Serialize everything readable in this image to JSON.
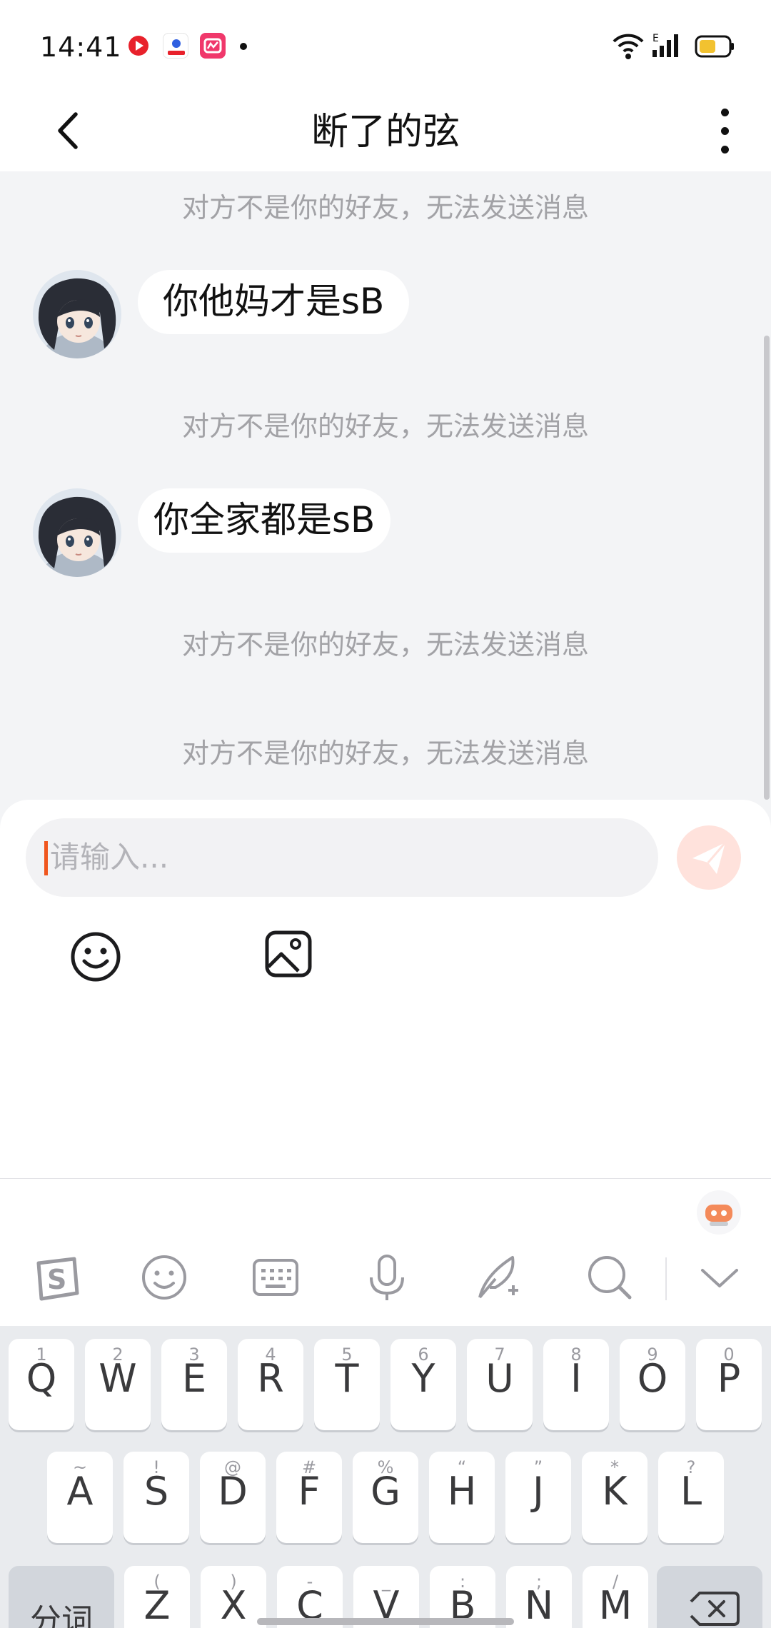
{
  "status_bar": {
    "time": "14:41",
    "app_icons": [
      "video-app-icon",
      "baidu-icon",
      "beauty-camera-icon"
    ],
    "battery_color": "#f2c230"
  },
  "header": {
    "title": "断了的弦",
    "back_icon": "chevron-left-icon",
    "more_icon": "more-vertical-icon"
  },
  "chat": {
    "system_notice": "对方不是你的好友，无法发送消息",
    "messages": [
      {
        "type": "system",
        "text": "对方不是你的好友，无法发送消息"
      },
      {
        "type": "received",
        "text": "你他妈才是sB"
      },
      {
        "type": "system",
        "text": "对方不是你的好友，无法发送消息"
      },
      {
        "type": "received",
        "text": "你全家都是sB"
      },
      {
        "type": "system",
        "text": "对方不是你的好友，无法发送消息"
      },
      {
        "type": "system",
        "text": "对方不是你的好友，无法发送消息"
      }
    ]
  },
  "composer": {
    "placeholder": "请输入...",
    "value": "",
    "send_icon": "paper-plane-icon",
    "accent": "#ff6b4d",
    "tools": [
      "emoji-icon",
      "image-icon"
    ]
  },
  "keyboard": {
    "toolbar_icons": [
      "sogou-logo-icon",
      "emoji-icon",
      "keyboard-icon",
      "microphone-icon",
      "quill-icon",
      "search-icon",
      "chevron-down-icon"
    ],
    "row1": [
      {
        "hint": "1",
        "key": "Q"
      },
      {
        "hint": "2",
        "key": "W"
      },
      {
        "hint": "3",
        "key": "E"
      },
      {
        "hint": "4",
        "key": "R"
      },
      {
        "hint": "5",
        "key": "T"
      },
      {
        "hint": "6",
        "key": "Y"
      },
      {
        "hint": "7",
        "key": "U"
      },
      {
        "hint": "8",
        "key": "I"
      },
      {
        "hint": "9",
        "key": "O"
      },
      {
        "hint": "0",
        "key": "P"
      }
    ],
    "row2": [
      {
        "hint": "~",
        "key": "A"
      },
      {
        "hint": "!",
        "key": "S"
      },
      {
        "hint": "@",
        "key": "D"
      },
      {
        "hint": "#",
        "key": "F"
      },
      {
        "hint": "%",
        "key": "G"
      },
      {
        "hint": "“",
        "key": "H"
      },
      {
        "hint": "”",
        "key": "J"
      },
      {
        "hint": "*",
        "key": "K"
      },
      {
        "hint": "?",
        "key": "L"
      }
    ],
    "row3": [
      {
        "hint": "(",
        "key": "Z"
      },
      {
        "hint": ")",
        "key": "X"
      },
      {
        "hint": "-",
        "key": "C"
      },
      {
        "hint": "_",
        "key": "V"
      },
      {
        "hint": ":",
        "key": "B"
      },
      {
        "hint": ";",
        "key": "N"
      },
      {
        "hint": "/",
        "key": "M"
      }
    ],
    "segment_key": "分词",
    "delete_icon": "backspace-icon"
  }
}
